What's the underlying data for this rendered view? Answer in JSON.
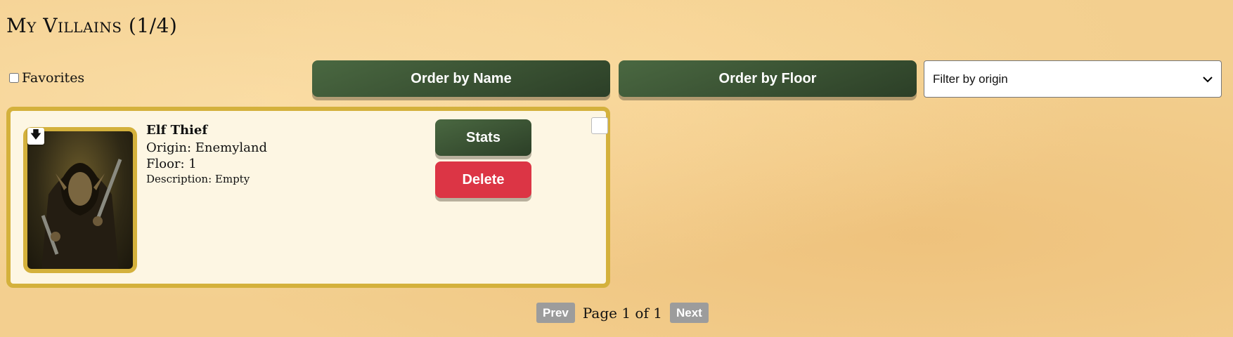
{
  "header": {
    "title": "My Villains (1/4)"
  },
  "toolbar": {
    "favorites_label": "Favorites",
    "order_by_name": "Order by Name",
    "order_by_floor": "Order by Floor",
    "filter_selected": "Filter by origin"
  },
  "villains": [
    {
      "name": "Elf Thief",
      "origin": "Origin: Enemyland",
      "floor": "Floor: 1",
      "description": "Description: Empty",
      "stats_label": "Stats",
      "delete_label": "Delete",
      "download_icon": "🡇"
    }
  ],
  "pagination": {
    "prev": "Prev",
    "status": "Page 1 of 1",
    "next": "Next"
  },
  "colors": {
    "green": "#3b5534",
    "gold": "#d4b13c",
    "red": "#dc3545",
    "card": "#fdf6e3"
  }
}
